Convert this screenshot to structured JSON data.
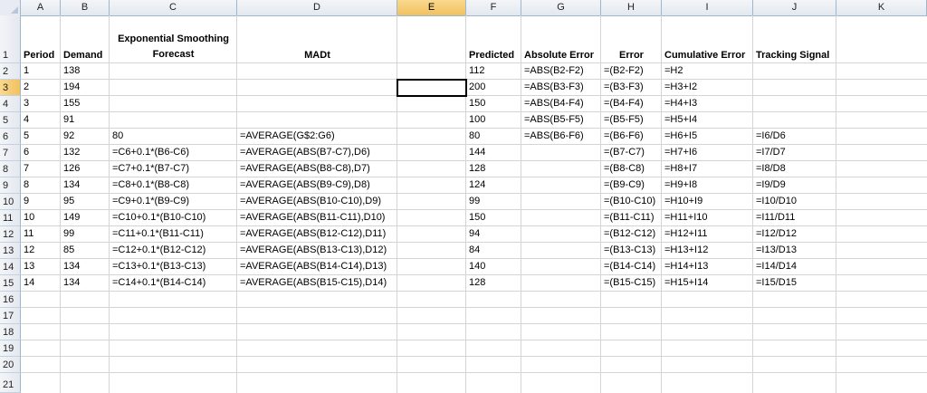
{
  "columns": [
    "A",
    "B",
    "C",
    "D",
    "E",
    "F",
    "G",
    "H",
    "I",
    "J",
    "K"
  ],
  "rows": [
    "1",
    "2",
    "3",
    "4",
    "5",
    "6",
    "7",
    "8",
    "9",
    "10",
    "11",
    "12",
    "13",
    "14",
    "15",
    "16",
    "17",
    "18",
    "19",
    "20",
    "21"
  ],
  "selected_column": "E",
  "selected_row": "3",
  "headers": {
    "period": "Period",
    "demand": "Demand",
    "es_line1": "Exponential Smoothing",
    "es_line2": "Forecast",
    "madt": "MADt",
    "predicted": "Predicted",
    "abs_error": "Absolute Error",
    "error": "Error",
    "cum_error": "Cumulative Error",
    "tracking": "Tracking Signal"
  },
  "data_rows": [
    {
      "period": "1",
      "demand": "138",
      "forecast": "",
      "madt": "",
      "predicted": "112",
      "abs": "=ABS(B2-F2)",
      "err": "=(B2-F2)",
      "cum": "=H2",
      "ts": ""
    },
    {
      "period": "2",
      "demand": "194",
      "forecast": "",
      "madt": "",
      "predicted": "200",
      "abs": "=ABS(B3-F3)",
      "err": "=(B3-F3)",
      "cum": "=H3+I2",
      "ts": ""
    },
    {
      "period": "3",
      "demand": "155",
      "forecast": "",
      "madt": "",
      "predicted": "150",
      "abs": "=ABS(B4-F4)",
      "err": "=(B4-F4)",
      "cum": "=H4+I3",
      "ts": ""
    },
    {
      "period": "4",
      "demand": "91",
      "forecast": "",
      "madt": "",
      "predicted": "100",
      "abs": "=ABS(B5-F5)",
      "err": "=(B5-F5)",
      "cum": "=H5+I4",
      "ts": ""
    },
    {
      "period": "5",
      "demand": "92",
      "forecast": "80",
      "madt": "=AVERAGE(G$2:G6)",
      "predicted": "80",
      "abs": "=ABS(B6-F6)",
      "err": "=(B6-F6)",
      "cum": "=H6+I5",
      "ts": "=I6/D6"
    },
    {
      "period": "6",
      "demand": "132",
      "forecast": "=C6+0.1*(B6-C6)",
      "madt": "=AVERAGE(ABS(B7-C7),D6)",
      "predicted": "144",
      "abs": "",
      "err": "=(B7-C7)",
      "cum": "=H7+I6",
      "ts": "=I7/D7"
    },
    {
      "period": "7",
      "demand": "126",
      "forecast": "=C7+0.1*(B7-C7)",
      "madt": "=AVERAGE(ABS(B8-C8),D7)",
      "predicted": "128",
      "abs": "",
      "err": "=(B8-C8)",
      "cum": "=H8+I7",
      "ts": "=I8/D8"
    },
    {
      "period": "8",
      "demand": "134",
      "forecast": "=C8+0.1*(B8-C8)",
      "madt": "=AVERAGE(ABS(B9-C9),D8)",
      "predicted": "124",
      "abs": "",
      "err": "=(B9-C9)",
      "cum": "=H9+I8",
      "ts": "=I9/D9"
    },
    {
      "period": "9",
      "demand": "95",
      "forecast": "=C9+0.1*(B9-C9)",
      "madt": "=AVERAGE(ABS(B10-C10),D9)",
      "predicted": "99",
      "abs": "",
      "err": "=(B10-C10)",
      "cum": "=H10+I9",
      "ts": "=I10/D10"
    },
    {
      "period": "10",
      "demand": "149",
      "forecast": "=C10+0.1*(B10-C10)",
      "madt": "=AVERAGE(ABS(B11-C11),D10)",
      "predicted": "150",
      "abs": "",
      "err": "=(B11-C11)",
      "cum": "=H11+I10",
      "ts": "=I11/D11"
    },
    {
      "period": "11",
      "demand": "99",
      "forecast": "=C11+0.1*(B11-C11)",
      "madt": "=AVERAGE(ABS(B12-C12),D11)",
      "predicted": "94",
      "abs": "",
      "err": "=(B12-C12)",
      "cum": "=H12+I11",
      "ts": "=I12/D12"
    },
    {
      "period": "12",
      "demand": "85",
      "forecast": "=C12+0.1*(B12-C12)",
      "madt": "=AVERAGE(ABS(B13-C13),D12)",
      "predicted": "84",
      "abs": "",
      "err": "=(B13-C13)",
      "cum": "=H13+I12",
      "ts": "=I13/D13"
    },
    {
      "period": "13",
      "demand": "134",
      "forecast": "=C13+0.1*(B13-C13)",
      "madt": "=AVERAGE(ABS(B14-C14),D13)",
      "predicted": "140",
      "abs": "",
      "err": "=(B14-C14)",
      "cum": "=H14+I13",
      "ts": "=I14/D14"
    },
    {
      "period": "14",
      "demand": "134",
      "forecast": "=C14+0.1*(B14-C14)",
      "madt": "=AVERAGE(ABS(B15-C15),D14)",
      "predicted": "128",
      "abs": "",
      "err": "=(B15-C15)",
      "cum": "=H15+I14",
      "ts": "=I15/D15"
    }
  ]
}
